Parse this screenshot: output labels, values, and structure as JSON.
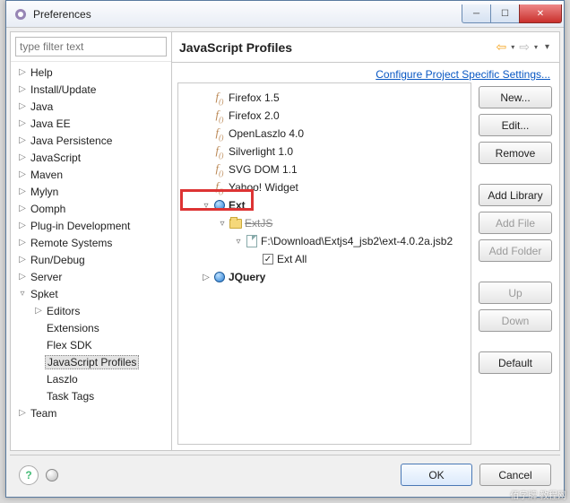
{
  "title": "Preferences",
  "filter_placeholder": "type filter text",
  "categories": [
    {
      "label": "Help",
      "exp": "▷"
    },
    {
      "label": "Install/Update",
      "exp": "▷"
    },
    {
      "label": "Java",
      "exp": "▷"
    },
    {
      "label": "Java EE",
      "exp": "▷"
    },
    {
      "label": "Java Persistence",
      "exp": "▷"
    },
    {
      "label": "JavaScript",
      "exp": "▷"
    },
    {
      "label": "Maven",
      "exp": "▷"
    },
    {
      "label": "Mylyn",
      "exp": "▷"
    },
    {
      "label": "Oomph",
      "exp": "▷"
    },
    {
      "label": "Plug-in Development",
      "exp": "▷"
    },
    {
      "label": "Remote Systems",
      "exp": "▷"
    },
    {
      "label": "Run/Debug",
      "exp": "▷"
    },
    {
      "label": "Server",
      "exp": "▷"
    },
    {
      "label": "Spket",
      "exp": "▿"
    },
    {
      "label": "Team",
      "exp": "▷"
    }
  ],
  "spket_children": [
    {
      "label": "Editors",
      "exp": "▷"
    },
    {
      "label": "Extensions",
      "exp": ""
    },
    {
      "label": "Flex SDK",
      "exp": ""
    },
    {
      "label": "JavaScript Profiles",
      "exp": "",
      "selected": true
    },
    {
      "label": "Laszlo",
      "exp": ""
    },
    {
      "label": "Task Tags",
      "exp": ""
    }
  ],
  "page": {
    "title": "JavaScript Profiles",
    "config_link": "Configure Project Specific Settings..."
  },
  "profiles": [
    {
      "name": "Firefox 1.5"
    },
    {
      "name": "Firefox 2.0"
    },
    {
      "name": "OpenLaszlo 4.0"
    },
    {
      "name": "Silverlight 1.0"
    },
    {
      "name": "SVG DOM 1.1"
    },
    {
      "name": "Yahoo! Widget"
    }
  ],
  "ext_node": {
    "name": "Ext",
    "children": [
      {
        "name": "ExtJS",
        "strike": true,
        "children": [
          {
            "name": "F:\\Download\\Extjs4_jsb2\\ext-4.0.2a.jsb2",
            "children": [
              {
                "name": "Ext All",
                "checked": true
              }
            ]
          }
        ]
      }
    ]
  },
  "jquery_node": {
    "name": "JQuery"
  },
  "buttons": {
    "new": "New...",
    "edit": "Edit...",
    "remove": "Remove",
    "add_library": "Add Library",
    "add_file": "Add File",
    "add_folder": "Add Folder",
    "up": "Up",
    "down": "Down",
    "default": "Default"
  },
  "footer": {
    "ok": "OK",
    "cancel": "Cancel"
  },
  "watermark": "佰字牌 教程网"
}
